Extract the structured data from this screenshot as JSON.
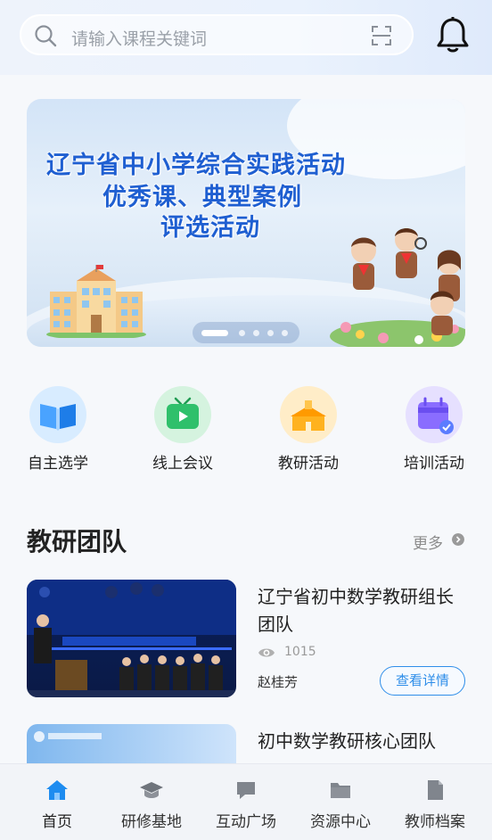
{
  "search": {
    "placeholder": "请输入课程关键词"
  },
  "banner": {
    "line1": "辽宁省中小学综合实践活动",
    "line2": "优秀课、典型案例",
    "line3": "评选活动",
    "dots": 5,
    "active_dot": 0
  },
  "quick_entries": [
    {
      "label": "自主选学",
      "icon": "open-book-icon",
      "color": "#4aa3ff"
    },
    {
      "label": "线上会议",
      "icon": "tv-play-icon",
      "color": "#2fc06b"
    },
    {
      "label": "教研活动",
      "icon": "school-building-icon",
      "color": "#ffb21f"
    },
    {
      "label": "培训活动",
      "icon": "calendar-check-icon",
      "color": "#8a6dff"
    }
  ],
  "section": {
    "title": "教研团队",
    "more_label": "更多"
  },
  "teams": [
    {
      "title": "辽宁省初中数学教研组长团队",
      "views": "1015",
      "author": "赵桂芳",
      "detail_label": "查看详情"
    },
    {
      "title": "初中数学教研核心团队"
    }
  ],
  "tabbar": [
    {
      "label": "首页",
      "icon": "home-icon",
      "active": true
    },
    {
      "label": "研修基地",
      "icon": "graduation-cap-icon",
      "active": false
    },
    {
      "label": "互动广场",
      "icon": "chat-bubble-icon",
      "active": false
    },
    {
      "label": "资源中心",
      "icon": "folder-icon",
      "active": false
    },
    {
      "label": "教师档案",
      "icon": "document-icon",
      "active": false
    }
  ],
  "colors": {
    "accent": "#2f8ee9",
    "banner_text": "#1f5fd1",
    "tab_active": "#1e8cf0"
  }
}
